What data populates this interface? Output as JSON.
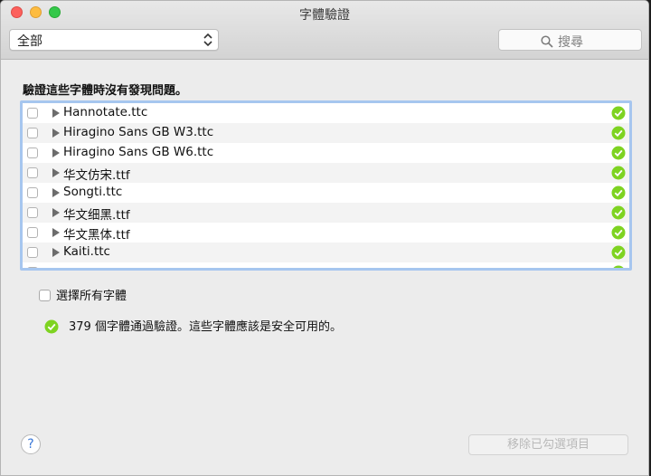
{
  "window": {
    "title": "字體驗證"
  },
  "toolbar": {
    "filter": {
      "selected": "全部"
    },
    "search": {
      "label": "搜尋"
    }
  },
  "heading": "驗證這些字體時沒有發現問題。",
  "fonts": [
    {
      "name": "Hannotate.ttc"
    },
    {
      "name": "Hiragino Sans GB W3.ttc"
    },
    {
      "name": "Hiragino Sans GB W6.ttc"
    },
    {
      "name": "华文仿宋.ttf"
    },
    {
      "name": "Songti.ttc"
    },
    {
      "name": "华文细黑.ttf"
    },
    {
      "name": "华文黑体.ttf"
    },
    {
      "name": "Kaiti.ttc"
    }
  ],
  "select_all_label": "選擇所有字體",
  "status_text": "379 個字體通過驗證。這些字體應該是安全可用的。",
  "help_label": "?",
  "remove_button_label": "移除已勾選項目",
  "colors": {
    "ok_green": "#7ed321",
    "focus_ring": "#a6c6ef"
  },
  "icons": {
    "status_ok": "green-check-circle-icon",
    "search": "magnifier-icon",
    "expand": "disclosure-triangle-icon"
  }
}
